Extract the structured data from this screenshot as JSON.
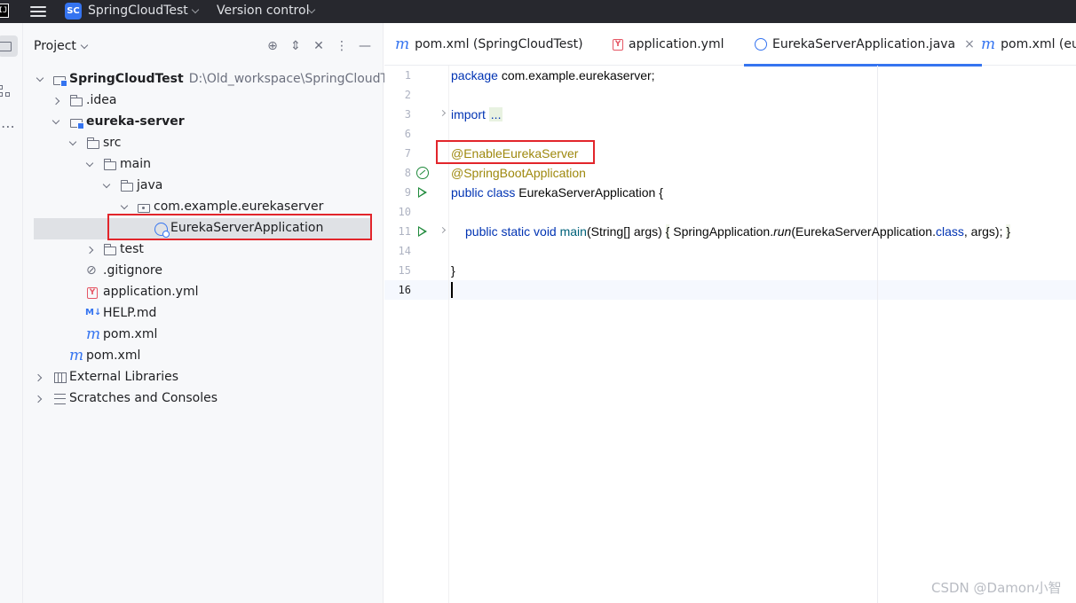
{
  "titlebar": {
    "app_logo": "IJ",
    "project_badge": "SC",
    "project_name": "SpringCloudTest",
    "version_control": "Version control"
  },
  "project_panel": {
    "title": "Project",
    "tree": [
      {
        "label": "SpringCloudTest",
        "path": "D:\\Old_workspace\\SpringCloudTest",
        "bold": true,
        "icon": "module-icon"
      },
      {
        "label": ".idea",
        "icon": "folder-icon"
      },
      {
        "label": "eureka-server",
        "bold": true,
        "icon": "module-icon"
      },
      {
        "label": "src",
        "icon": "folder-icon"
      },
      {
        "label": "main",
        "icon": "folder-icon"
      },
      {
        "label": "java",
        "icon": "folder-icon"
      },
      {
        "label": "com.example.eurekaserver",
        "icon": "package-icon"
      },
      {
        "label": "EurekaServerApplication",
        "icon": "class-icon",
        "selected": true
      },
      {
        "label": "test",
        "icon": "folder-icon"
      },
      {
        "label": ".gitignore",
        "icon": "ignore-icon"
      },
      {
        "label": "application.yml",
        "icon": "yaml-icon"
      },
      {
        "label": "HELP.md",
        "icon": "markdown-icon"
      },
      {
        "label": "pom.xml",
        "icon": "maven-icon"
      },
      {
        "label": "pom.xml",
        "icon": "maven-icon"
      },
      {
        "label": "External Libraries",
        "icon": "library-icon"
      },
      {
        "label": "Scratches and Consoles",
        "icon": "scratches-icon"
      }
    ]
  },
  "editor": {
    "tabs": [
      {
        "label": "pom.xml (SpringCloudTest)",
        "icon": "maven-icon"
      },
      {
        "label": "application.yml",
        "icon": "yaml-icon"
      },
      {
        "label": "EurekaServerApplication.java",
        "icon": "class-icon",
        "active": true
      },
      {
        "label": "pom.xml (eur",
        "icon": "maven-icon"
      }
    ],
    "line_numbers": [
      "1",
      "2",
      "3",
      "6",
      "7",
      "8",
      "9",
      "10",
      "11",
      "14",
      "15",
      "16"
    ],
    "code": {
      "l1_kw": "package",
      "l1_rest": " com.example.eurekaserver;",
      "l3_kw": "import",
      "l3_dots": "...",
      "l7_ann": "@EnableEurekaServer",
      "l8_ann": "@SpringBootApplication",
      "l9_kw": "public class",
      "l9_rest": " EurekaServerApplication {",
      "l11_kw": "public static void",
      "l11_method": "main",
      "l11_a": "(String[] args) ",
      "l11_brace_open": "{",
      "l11_b": " SpringApplication.",
      "l11_run": "run",
      "l11_c": "(EurekaServerApplication.",
      "l11_class_kw": "class",
      "l11_d": ", args); ",
      "l11_brace_close": "}",
      "l15": "}"
    }
  },
  "watermark": "CSDN @Damon小智",
  "colors": {
    "accent": "#3574f0",
    "highlight_box": "#e2252b",
    "keyword": "#0033b3",
    "annotation": "#9e880d",
    "run_icon": "#208a3c"
  }
}
